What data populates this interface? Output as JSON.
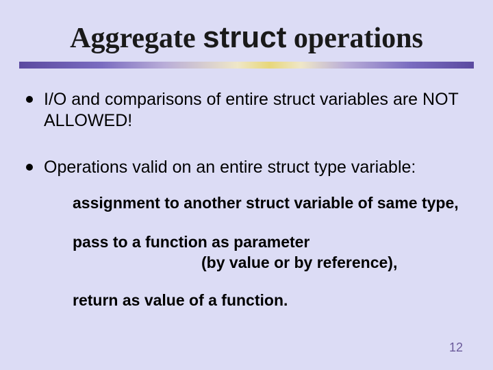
{
  "title": {
    "pre": "Aggregate ",
    "kw": "struct",
    "post": " operations"
  },
  "bullets": [
    "I/O and comparisons of entire struct variables are NOT ALLOWED!",
    "Operations valid on an entire struct type variable:"
  ],
  "subs": {
    "s1": "assignment to another struct variable of same type,",
    "s2a": "pass to a function as parameter",
    "s2b": "(by value or by reference),",
    "s3": "return as value of a function."
  },
  "page_number": "12"
}
